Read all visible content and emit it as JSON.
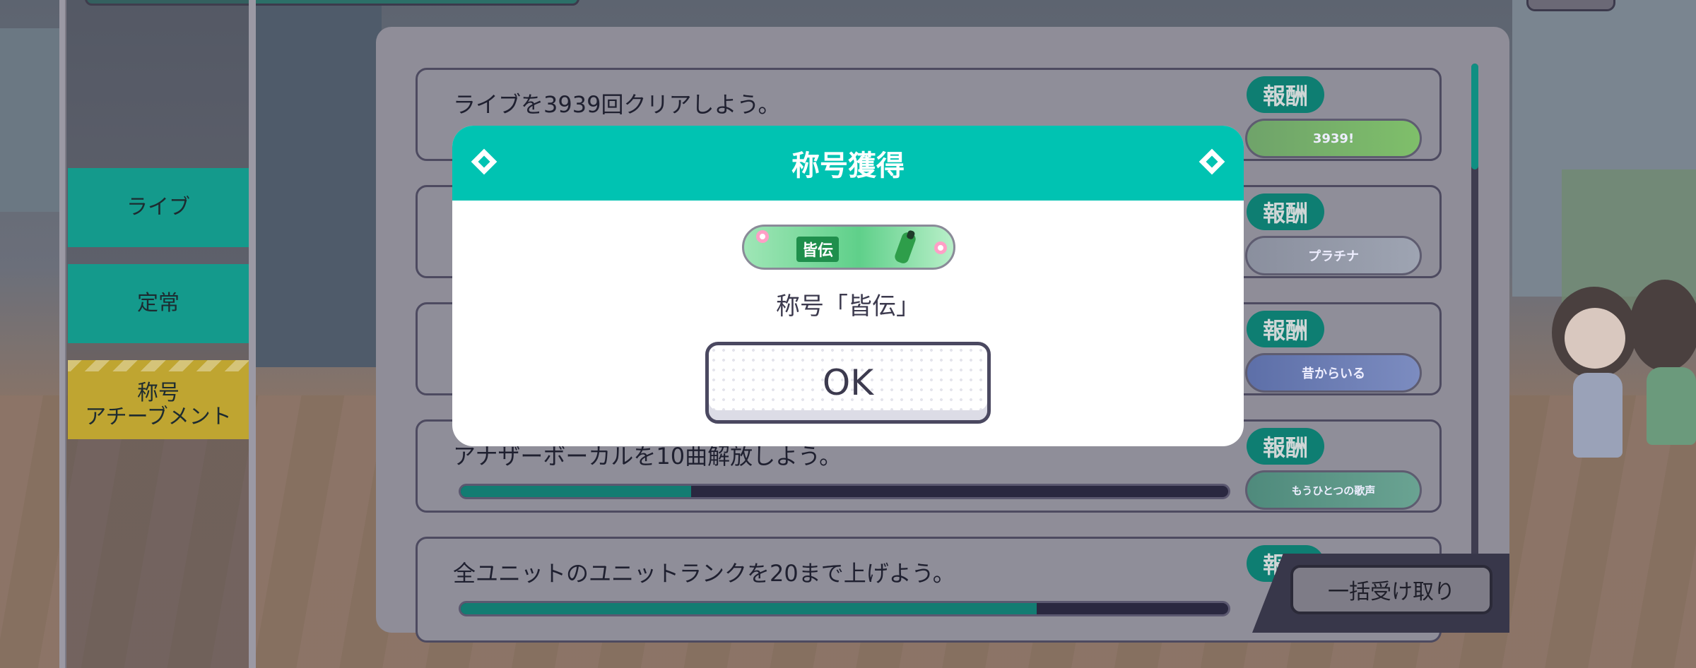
{
  "sidebar": {
    "tabs": [
      {
        "label": "ライブ"
      },
      {
        "label": "定常"
      },
      {
        "label": "称号\nアチーブメント"
      }
    ]
  },
  "list": {
    "items": [
      {
        "text": "ライブを3939回クリアしよう。",
        "reward_label": "報酬",
        "reward_title": "3939!",
        "progress": null
      },
      {
        "text": "",
        "reward_label": "報酬",
        "reward_title": "プラチナ",
        "progress": null
      },
      {
        "text": "",
        "reward_label": "報酬",
        "reward_title": "昔からいる",
        "progress": null
      },
      {
        "text": "アナザーボーカルを10曲解放しよう。",
        "reward_label": "報酬",
        "reward_title": "もうひとつの歌声",
        "progress": 0.3
      },
      {
        "text": "全ユニットのユニットランクを20まで上げよう。",
        "reward_label": "報酬",
        "reward_title": "",
        "progress": 0.75
      }
    ],
    "bulk_receive_label": "一括受け取り"
  },
  "modal": {
    "title": "称号獲得",
    "plate_label": "皆伝",
    "acquired_text": "称号「皆伝」",
    "ok_label": "OK"
  },
  "colors": {
    "accent_teal": "#00c3b2",
    "dim_teal": "#0e7e72",
    "tab_yellow": "#bfa531"
  }
}
